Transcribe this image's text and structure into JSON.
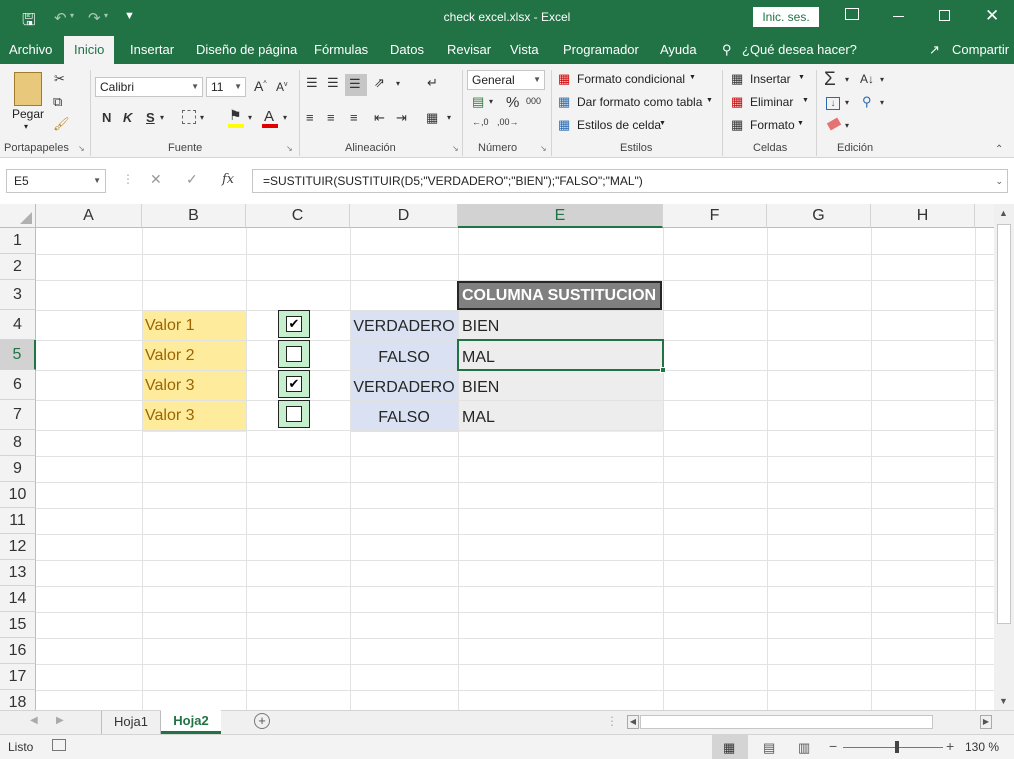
{
  "title_bar": {
    "document_title": "check excel.xlsx  -  Excel",
    "sign_in_label": "Inic. ses.",
    "save_icon": "save-icon",
    "undo_icon": "undo-icon",
    "redo_icon": "redo-icon"
  },
  "ribbon_tabs": {
    "archivo": "Archivo",
    "inicio": "Inicio",
    "insertar": "Insertar",
    "diseno": "Diseño de página",
    "formulas": "Fórmulas",
    "datos": "Datos",
    "revisar": "Revisar",
    "vista": "Vista",
    "programador": "Programador",
    "ayuda": "Ayuda",
    "tell_me": "¿Qué desea hacer?",
    "share": "Compartir"
  },
  "ribbon": {
    "paste_label": "Pegar",
    "font_name": "Calibri",
    "font_size": "11",
    "bold": "N",
    "italic": "K",
    "underline": "S",
    "number_format": "General",
    "conditional_format": "Formato condicional",
    "format_as_table": "Dar formato como tabla",
    "cell_styles": "Estilos de celda",
    "insert": "Insertar",
    "delete": "Eliminar",
    "format": "Formato",
    "groups": {
      "clipboard": "Portapapeles",
      "font": "Fuente",
      "alignment": "Alineación",
      "number": "Número",
      "styles": "Estilos",
      "cells": "Celdas",
      "editing": "Edición"
    }
  },
  "formula_bar": {
    "name_box": "E5",
    "fx": "fx",
    "formula": "=SUSTITUIR(SUSTITUIR(D5;\"VERDADERO\";\"BIEN\");\"FALSO\";\"MAL\")"
  },
  "columns": [
    "A",
    "B",
    "C",
    "D",
    "E",
    "F",
    "G",
    "H"
  ],
  "rows": [
    "1",
    "2",
    "3",
    "4",
    "5",
    "6",
    "7",
    "8",
    "9",
    "10",
    "11",
    "12",
    "13",
    "14",
    "15",
    "16",
    "17",
    "18"
  ],
  "cells": {
    "B4": "Valor 1",
    "B5": "Valor 2",
    "B6": "Valor 3",
    "B7": "Valor 3",
    "C4": "✔",
    "C5": "",
    "C6": "✔",
    "C7": "",
    "D4": "VERDADERO",
    "D5": "FALSO",
    "D6": "VERDADERO",
    "D7": "FALSO",
    "E3": "COLUMNA SUSTITUCION",
    "E4": "BIEN",
    "E5": "MAL",
    "E6": "BIEN",
    "E7": "MAL"
  },
  "sheets": {
    "hoja1": "Hoja1",
    "hoja2": "Hoja2"
  },
  "status": {
    "ready": "Listo",
    "zoom": "130 %"
  },
  "colors": {
    "excel_green": "#217346",
    "yellow_fill": "#ffeb9c",
    "yellow_text": "#9c6500",
    "checkbox_fill": "#c6efce",
    "blue_fill": "#d9e1f2",
    "gray_fill": "#ededed",
    "header_fill": "#808080"
  }
}
